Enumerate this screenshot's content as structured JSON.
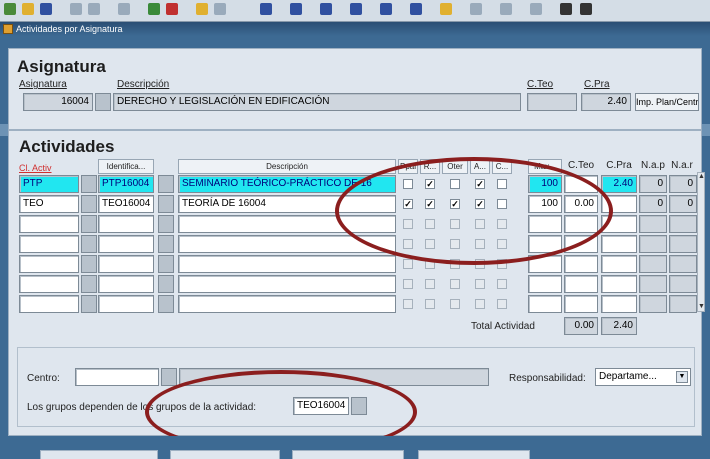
{
  "window": {
    "title": "Actividades por Asignatura"
  },
  "asignatura": {
    "heading": "Asignatura",
    "label_asignatura": "Asignatura",
    "label_descripcion": "Descripción",
    "label_cteo": "C.Teo",
    "label_cpra": "C.Pra",
    "code": "16004",
    "descripcion": "DERECHO Y LEGISLACIÓN EN EDIFICACIÓN",
    "cteo": "",
    "cpra": "2.40",
    "imp_button": "Imp. Plan/Centro"
  },
  "actividades": {
    "heading": "Actividades",
    "columns": {
      "cl_activ": "Cl. Activ",
      "identifica": "Identifica...",
      "descripcion": "Descripción",
      "ppal": "Ppal",
      "r": "R...",
      "oter": "Oter",
      "a": "A...",
      "c": "C...",
      "max": "Max...",
      "cteo": "C.Teo",
      "cpra": "C.Pra",
      "nap": "N.a.p",
      "nar": "N.a.r"
    },
    "rows": [
      {
        "cl": "PTP",
        "id": "PTP16004",
        "desc": "SEMINARIO TEÓRICO-PRÁCTICO DE 16",
        "ppal": "",
        "r": "✓",
        "oter": "",
        "a": "✓",
        "c": "",
        "max": "100",
        "cteo": "",
        "cpra": "2.40",
        "nap": "0",
        "nar": "0"
      },
      {
        "cl": "TEO",
        "id": "TEO16004",
        "desc": "TEORÍA DE 16004",
        "ppal": "✓",
        "r": "✓",
        "oter": "✓",
        "a": "✓",
        "c": "",
        "max": "100",
        "cteo": "0.00",
        "cpra": "",
        "nap": "0",
        "nar": "0"
      }
    ],
    "total_label": "Total Actividad",
    "total_cteo": "0.00",
    "total_cpra": "2.40",
    "centro_label": "Centro:",
    "centro_value": "",
    "responsabilidad_label": "Responsabilidad:",
    "responsabilidad_value": "Departame...",
    "grupos_label": "Los grupos dependen de los grupos de la actividad:",
    "grupos_value": "TEO16004"
  },
  "colors": {
    "highlight": "#21e6f0",
    "annotation": "#8b1e1e"
  }
}
